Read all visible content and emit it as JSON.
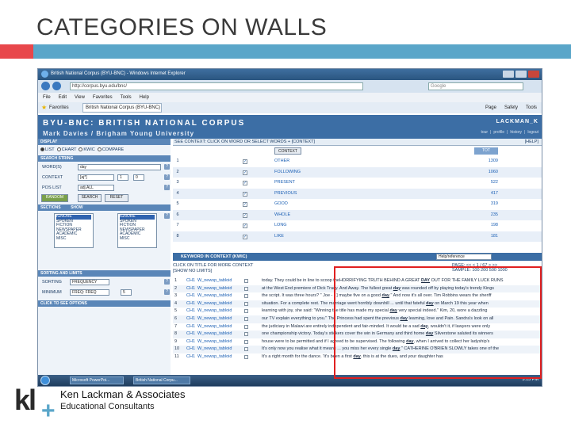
{
  "slide": {
    "title": "CATEGORIES ON WALLS",
    "company": "Ken Lackman & Associates",
    "tagline": "Educational Consultants",
    "logo_text": "kl+",
    "colors": {
      "accent_red": "#e8474b",
      "accent_blue": "#5aa6c9"
    }
  },
  "browser": {
    "window_title": "British National Corpus (BYU-BNC) - Windows Internet Explorer",
    "address": "http://corpus.byu.edu/bnc/",
    "search_placeholder": "Google",
    "menu": [
      "File",
      "Edit",
      "View",
      "Favorites",
      "Tools",
      "Help"
    ],
    "favorites_label": "Favorites",
    "tab_label": "British National Corpus (BYU-BNC)",
    "toolbar": [
      "Page",
      "Safety",
      "Tools"
    ]
  },
  "bnc": {
    "title": "BYU-BNC: BRITISH NATIONAL CORPUS",
    "subtitle": "Mark Davies / Brigham Young University",
    "user": "LACKMAN_K",
    "links": [
      "tour",
      "profile",
      "history",
      "logout"
    ]
  },
  "left_panel": {
    "display_head": "DISPLAY",
    "display_options": [
      "LIST",
      "CHART",
      "KWIC",
      "COMPARE"
    ],
    "search_head": "SEARCH STRING",
    "word_label": "WORD(S)",
    "word_value": "day",
    "context_label": "CONTEXT",
    "context_value": "[aj*]",
    "context_left": "1",
    "context_right": "0",
    "pos_label": "POS LIST",
    "pos_value": "adj.ALL",
    "random_label": "RANDOM",
    "search_button": "SEARCH",
    "reset_button": "RESET",
    "sections_head": "SECTIONS",
    "show_label": "SHOW",
    "sections_1": [
      "IGNORE",
      "SPOKEN",
      "FICTION",
      "NEWSPAPER",
      "ACADEMIC",
      "MISC"
    ],
    "sections_2": [
      "IGNORE",
      "SPOKEN",
      "FICTION",
      "NEWSPAPER",
      "ACADEMIC",
      "MISC"
    ],
    "sorting_head": "SORTING AND LIMITS",
    "sorting_label": "SORTING",
    "sorting_value": "FREQUENCY",
    "minimum_label": "MINIMUM",
    "minimum_value": "FREQ: FREQ",
    "minimum_num": "5",
    "options_head": "CLICK TO SEE OPTIONS"
  },
  "frequency": {
    "header": "SEE CONTEXT: CLICK ON WORD OR SELECT WORDS + [CONTEXT]",
    "help": "[HELP]",
    "context_button": "CONTEXT",
    "freq_col": "TOT",
    "rows": [
      {
        "n": "1",
        "word": "OTHER",
        "freq": "1309"
      },
      {
        "n": "2",
        "word": "FOLLOWING",
        "freq": "1060"
      },
      {
        "n": "3",
        "word": "PRESENT",
        "freq": "522"
      },
      {
        "n": "4",
        "word": "PREVIOUS",
        "freq": "417"
      },
      {
        "n": "5",
        "word": "GOOD",
        "freq": "319"
      },
      {
        "n": "6",
        "word": "WHOLE",
        "freq": "235"
      },
      {
        "n": "7",
        "word": "LONG",
        "freq": "198"
      },
      {
        "n": "8",
        "word": "LIKE",
        "freq": "181"
      }
    ]
  },
  "kwic": {
    "bar_label": "KEYWORD IN CONTEXT (KWIC)",
    "bar_select": "Help/reference",
    "click_title": "CLICK ON TITLE FOR MORE CONTEXT",
    "limits": "[SHOW NO LIMITS]",
    "page_label": "PAGE: << < 1 / 67 > >>",
    "sample_label": "SAMPLE: 100 200 500 1000",
    "rows": [
      {
        "n": "1",
        "a": "CH1",
        "b": "W_newsp_tabloid",
        "pre": "today. They could be in line to scoop the",
        "mid": "HORRIFYING TRUTH BEHIND A GREAT ",
        "kw": "DAY",
        "post": " OUT FOR THE FAMILY LUCK RUNS"
      },
      {
        "n": "2",
        "a": "CH1",
        "b": "W_newsp_tabloid",
        "pre": "at the West End premiere of Dick Tracy. And Away. The fullest great ",
        "mid": "",
        "kw": "day",
        "post": " was rounded off by playing today's trendy Kings"
      },
      {
        "n": "3",
        "a": "CH1",
        "b": "W_newsp_tabloid",
        "pre": "the script. It was three hours? \" Joe - - ] maybe five on a good ",
        "mid": "",
        "kw": "day",
        "post": ".\" And now it's all over. Tim Robbins wears the sheriff"
      },
      {
        "n": "4",
        "a": "CH1",
        "b": "W_newsp_tabloid",
        "pre": "situation. For a complete rest. The marriage went horribly downhill ... until that fateful ",
        "mid": "",
        "kw": "day",
        "post": " on March 19 this year when"
      },
      {
        "n": "5",
        "a": "CH1",
        "b": "W_newsp_tabloid",
        "pre": "learning with joy, she said: \"Winning the title has made my special ",
        "mid": "",
        "kw": "day",
        "post": " very special indeed.\" Kim, 20, wore a dazzling"
      },
      {
        "n": "6",
        "a": "CH1",
        "b": "W_newsp_tabloid",
        "pre": "our TV explain everything to you.\" The Princess had spent the previous ",
        "mid": "",
        "kw": "day",
        "post": " learning, love and Pain. Sandra's look on all"
      },
      {
        "n": "7",
        "a": "CH1",
        "b": "W_newsp_tabloid",
        "pre": "the judiciary in Malawi are entirely independent and fair-minded. It would be a sad ",
        "mid": "",
        "kw": "day",
        "post": ", wouldn't it, if lawyers were only"
      },
      {
        "n": "8",
        "a": "CH1",
        "b": "W_newsp_tabloid",
        "pre": "one championship victory. Today's stickers cover the win in Germany and third home ",
        "mid": "",
        "kw": "day",
        "post": " Silverstone saluted its winners"
      },
      {
        "n": "9",
        "a": "CH1",
        "b": "W_newsp_tabloid",
        "pre": "house were to be permitted and if I agreed to be supervised. The following ",
        "mid": "",
        "kw": "day",
        "post": ", when I arrived to collect her ladyship's"
      },
      {
        "n": "10",
        "a": "CH1",
        "b": "W_newsp_tabloid",
        "pre": "It's only now you realise what it means ... you miss her every single ",
        "mid": "",
        "kw": "day",
        "post": ".\" CATHERINE O'BRIEN SLOWLY takes one of the"
      },
      {
        "n": "11",
        "a": "CH1",
        "b": "W_newsp_tabloid",
        "pre": "It's a right month for the dance. 'It's been a first ",
        "mid": "",
        "kw": "day",
        "post": ". this is at the dues, and your daughter has"
      }
    ]
  },
  "taskbar": {
    "items": [
      "Microsoft PowerPoi...",
      "British National Corpu..."
    ],
    "clock": "5:13 PM"
  }
}
